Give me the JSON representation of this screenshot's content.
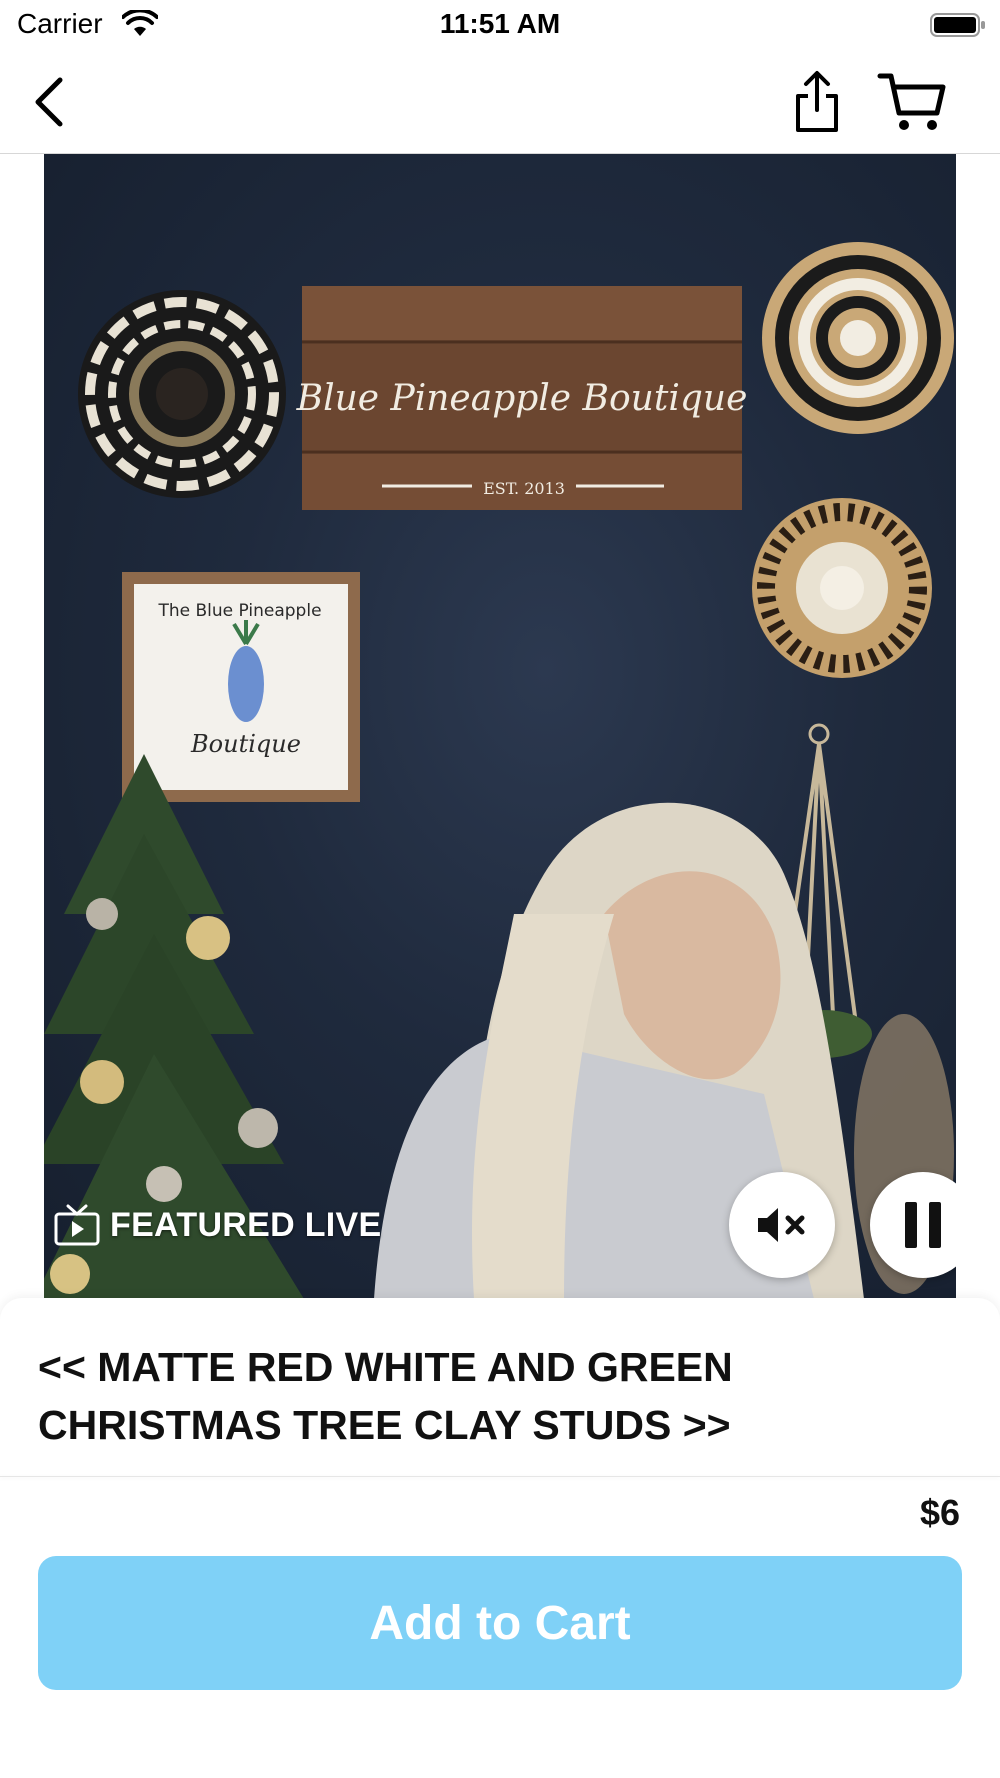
{
  "status_bar": {
    "carrier": "Carrier",
    "time": "11:51 AM"
  },
  "nav": {
    "back_icon": "chevron-left-icon",
    "share_icon": "share-icon",
    "cart_icon": "cart-icon"
  },
  "video": {
    "badge_label": "FEATURED LIVE",
    "badge_icon": "tv-play-icon",
    "mute_icon": "speaker-muted-icon",
    "pause_icon": "pause-icon",
    "sign_text": "Blue Pineapple Boutique",
    "sign_subtext": "EST. 2013",
    "poster_top": "The Blue Pineapple",
    "poster_bottom": "Boutique"
  },
  "product": {
    "title": "<< MATTE RED WHITE AND GREEN CHRISTMAS TREE CLAY STUDS >>",
    "price": "$6",
    "add_to_cart_label": "Add to Cart"
  },
  "colors": {
    "button": "#7fd1f7",
    "wall": "#1f2a3d"
  }
}
